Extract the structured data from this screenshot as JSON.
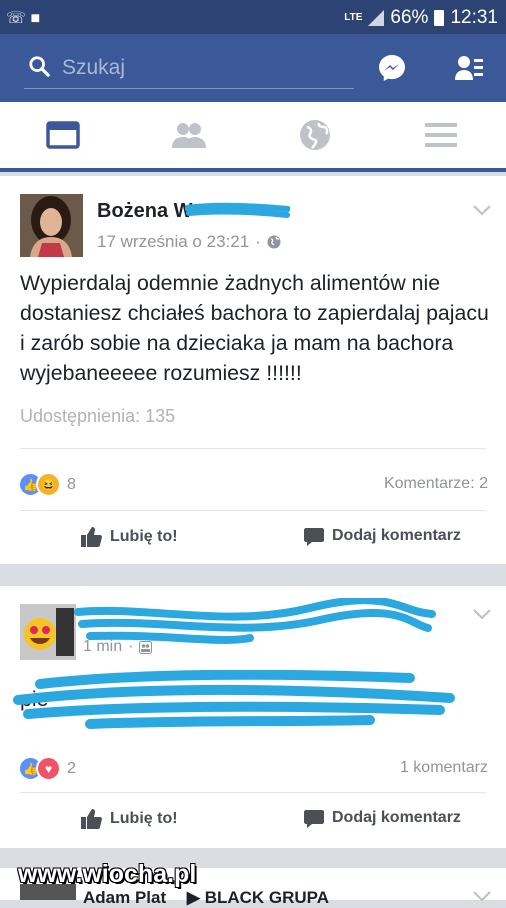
{
  "status_bar": {
    "network": "LTE",
    "battery": "66%",
    "time": "12:31"
  },
  "search": {
    "placeholder": "Szukaj"
  },
  "post1": {
    "author": "Bożena W",
    "date": "17 września o 23:21",
    "dot": "·",
    "text": "Wypierdalaj odemnie żadnych alimentów nie dostaniesz chciałeś bachora to zapierdalaj pajacu i zarób sobie na dzieciaka ja mam na bachora wyjebaneeeee rozumiesz !!!!!!",
    "shares": "Udostępnienia: 135",
    "reaction_count": "8",
    "comments": "Komentarze: 2",
    "like_label": "Lubię to!",
    "comment_label": "Dodaj komentarz"
  },
  "post2": {
    "meta": "1 min",
    "dot": "·",
    "text": "pie",
    "reaction_count": "2",
    "comments": "1 komentarz",
    "like_label": "Lubię to!",
    "comment_label": "Dodaj komentarz"
  },
  "post3": {
    "author": "Adam Plat",
    "group": "BLACK GRUPA"
  },
  "watermark": "www.wiocha.pl",
  "colors": {
    "header": "#3b5998",
    "status_bar": "#2d4373",
    "redaction": "#2ba8e0"
  }
}
